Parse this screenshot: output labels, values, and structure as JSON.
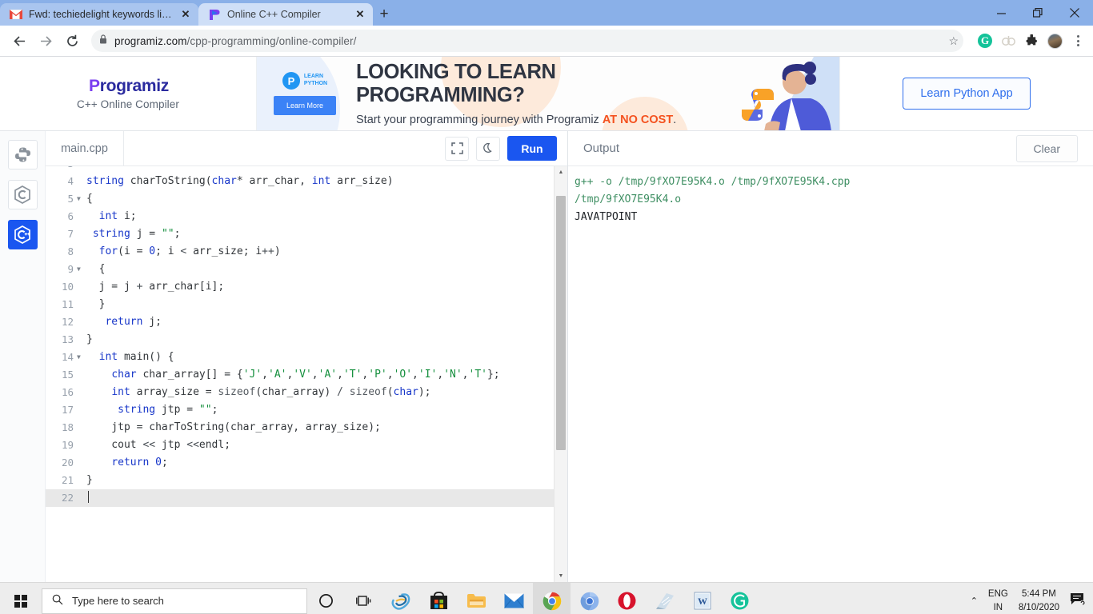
{
  "browser": {
    "tabs": [
      {
        "title": "Fwd: techiedelight keywords list -",
        "favicon": "gmail-icon",
        "active": false
      },
      {
        "title": "Online C++ Compiler",
        "favicon": "programiz-icon",
        "active": true
      }
    ],
    "newtab_label": "+",
    "window_controls": {
      "minimize": "—",
      "restore": "❐",
      "close": "✕"
    },
    "nav": {
      "back": "←",
      "forward": "→",
      "reload": "⟳"
    },
    "omnibox": {
      "lock_icon": "lock-icon",
      "domain": "programiz.com",
      "path": "/cpp-programming/online-compiler/",
      "full_url": "programiz.com/cpp-programming/online-compiler/",
      "star_icon": "☆"
    },
    "extensions": [
      {
        "name": "grammarly-extension-icon",
        "glyph": "G"
      },
      {
        "name": "link-extension-icon",
        "glyph": ""
      },
      {
        "name": "puzzle-extensions-icon",
        "glyph": ""
      },
      {
        "name": "profile-avatar",
        "glyph": ""
      }
    ]
  },
  "site": {
    "brand": {
      "logo_text": "rogramiz",
      "logo_first": "P",
      "subtitle": "C++ Online Compiler"
    },
    "ad": {
      "badge_line1": "LEARN",
      "badge_line2": "PYTHON",
      "badge_glyph": "P",
      "learn_more": "Learn More",
      "headline": "LOOKING TO LEARN PROGRAMMING?",
      "subline_pre": "Start your programming journey with Programiz ",
      "subline_bold": "AT NO COST",
      "subline_post": ".",
      "cta": "Learn Python App"
    }
  },
  "ide": {
    "languages": [
      {
        "name": "python-language-button",
        "label": "Python",
        "active": false
      },
      {
        "name": "c-language-button",
        "label": "C",
        "active": false
      },
      {
        "name": "cpp-language-button",
        "label": "C++",
        "active": true
      }
    ],
    "editor": {
      "filename": "main.cpp",
      "fullscreen_icon": "fullscreen-icon",
      "darkmode_icon": "moon-icon",
      "run_label": "Run",
      "current_line": 22,
      "lines": [
        {
          "n": 3,
          "fold": false,
          "clipped": true,
          "tokens": []
        },
        {
          "n": 4,
          "fold": false,
          "tokens": [
            {
              "t": "kw",
              "v": "string"
            },
            {
              "t": "ctext",
              "v": " charToString("
            },
            {
              "t": "kw",
              "v": "char"
            },
            {
              "t": "ctext",
              "v": "* arr_char, "
            },
            {
              "t": "kw",
              "v": "int"
            },
            {
              "t": "ctext",
              "v": " arr_size)"
            }
          ]
        },
        {
          "n": 5,
          "fold": true,
          "tokens": [
            {
              "t": "ctext",
              "v": "{"
            }
          ]
        },
        {
          "n": 6,
          "fold": false,
          "tokens": [
            {
              "t": "ctext",
              "v": "  "
            },
            {
              "t": "kw",
              "v": "int"
            },
            {
              "t": "ctext",
              "v": " i;"
            }
          ]
        },
        {
          "n": 7,
          "fold": false,
          "tokens": [
            {
              "t": "ctext",
              "v": " "
            },
            {
              "t": "kw",
              "v": "string"
            },
            {
              "t": "ctext",
              "v": " j = "
            },
            {
              "t": "str",
              "v": "\"\""
            },
            {
              "t": "ctext",
              "v": ";"
            }
          ]
        },
        {
          "n": 8,
          "fold": false,
          "tokens": [
            {
              "t": "ctext",
              "v": "  "
            },
            {
              "t": "kw",
              "v": "for"
            },
            {
              "t": "ctext",
              "v": "(i = "
            },
            {
              "t": "num",
              "v": "0"
            },
            {
              "t": "ctext",
              "v": "; i "
            },
            {
              "t": "op",
              "v": "<"
            },
            {
              "t": "ctext",
              "v": " arr_size; i"
            },
            {
              "t": "op",
              "v": "++"
            },
            {
              "t": "ctext",
              "v": ")"
            }
          ]
        },
        {
          "n": 9,
          "fold": true,
          "tokens": [
            {
              "t": "ctext",
              "v": "  {"
            }
          ]
        },
        {
          "n": 10,
          "fold": false,
          "tokens": [
            {
              "t": "ctext",
              "v": "  j = j "
            },
            {
              "t": "op",
              "v": "+"
            },
            {
              "t": "ctext",
              "v": " arr_char[i];"
            }
          ]
        },
        {
          "n": 11,
          "fold": false,
          "tokens": [
            {
              "t": "ctext",
              "v": "  }"
            }
          ]
        },
        {
          "n": 12,
          "fold": false,
          "tokens": [
            {
              "t": "ctext",
              "v": "   "
            },
            {
              "t": "kw",
              "v": "return"
            },
            {
              "t": "ctext",
              "v": " j;"
            }
          ]
        },
        {
          "n": 13,
          "fold": false,
          "tokens": [
            {
              "t": "ctext",
              "v": "}"
            }
          ]
        },
        {
          "n": 14,
          "fold": true,
          "tokens": [
            {
              "t": "ctext",
              "v": "  "
            },
            {
              "t": "kw",
              "v": "int"
            },
            {
              "t": "ctext",
              "v": " main() {"
            }
          ]
        },
        {
          "n": 15,
          "fold": false,
          "tokens": [
            {
              "t": "ctext",
              "v": "    "
            },
            {
              "t": "kw",
              "v": "char"
            },
            {
              "t": "ctext",
              "v": " char_array[] = {"
            },
            {
              "t": "str",
              "v": "'J'"
            },
            {
              "t": "ctext",
              "v": ","
            },
            {
              "t": "str",
              "v": "'A'"
            },
            {
              "t": "ctext",
              "v": ","
            },
            {
              "t": "str",
              "v": "'V'"
            },
            {
              "t": "ctext",
              "v": ","
            },
            {
              "t": "str",
              "v": "'A'"
            },
            {
              "t": "ctext",
              "v": ","
            },
            {
              "t": "str",
              "v": "'T'"
            },
            {
              "t": "ctext",
              "v": ","
            },
            {
              "t": "str",
              "v": "'P'"
            },
            {
              "t": "ctext",
              "v": ","
            },
            {
              "t": "str",
              "v": "'O'"
            },
            {
              "t": "ctext",
              "v": ","
            },
            {
              "t": "str",
              "v": "'I'"
            },
            {
              "t": "ctext",
              "v": ","
            },
            {
              "t": "str",
              "v": "'N'"
            },
            {
              "t": "ctext",
              "v": ","
            },
            {
              "t": "str",
              "v": "'T'"
            },
            {
              "t": "ctext",
              "v": "};"
            }
          ]
        },
        {
          "n": 16,
          "fold": false,
          "tokens": [
            {
              "t": "ctext",
              "v": "    "
            },
            {
              "t": "kw",
              "v": "int"
            },
            {
              "t": "ctext",
              "v": " array_size = "
            },
            {
              "t": "fn",
              "v": "sizeof"
            },
            {
              "t": "ctext",
              "v": "(char_array) "
            },
            {
              "t": "op",
              "v": "/"
            },
            {
              "t": "ctext",
              "v": " "
            },
            {
              "t": "fn",
              "v": "sizeof"
            },
            {
              "t": "ctext",
              "v": "("
            },
            {
              "t": "kw",
              "v": "char"
            },
            {
              "t": "ctext",
              "v": ");"
            }
          ]
        },
        {
          "n": 17,
          "fold": false,
          "tokens": [
            {
              "t": "ctext",
              "v": "     "
            },
            {
              "t": "kw",
              "v": "string"
            },
            {
              "t": "ctext",
              "v": " jtp = "
            },
            {
              "t": "str",
              "v": "\"\""
            },
            {
              "t": "ctext",
              "v": ";"
            }
          ]
        },
        {
          "n": 18,
          "fold": false,
          "tokens": [
            {
              "t": "ctext",
              "v": "    jtp = charToString(char_array, array_size);"
            }
          ]
        },
        {
          "n": 19,
          "fold": false,
          "tokens": [
            {
              "t": "ctext",
              "v": "    cout "
            },
            {
              "t": "op",
              "v": "<<"
            },
            {
              "t": "ctext",
              "v": " jtp "
            },
            {
              "t": "op",
              "v": "<<"
            },
            {
              "t": "ctext",
              "v": "endl;"
            }
          ]
        },
        {
          "n": 20,
          "fold": false,
          "tokens": [
            {
              "t": "ctext",
              "v": "    "
            },
            {
              "t": "kw",
              "v": "return"
            },
            {
              "t": "ctext",
              "v": " "
            },
            {
              "t": "num",
              "v": "0"
            },
            {
              "t": "ctext",
              "v": ";"
            }
          ]
        },
        {
          "n": 21,
          "fold": false,
          "tokens": [
            {
              "t": "ctext",
              "v": "}"
            }
          ]
        },
        {
          "n": 22,
          "fold": false,
          "tokens": []
        }
      ]
    },
    "output": {
      "title": "Output",
      "clear_label": "Clear",
      "lines": [
        {
          "kind": "cmd",
          "text": "g++ -o /tmp/9fXO7E95K4.o /tmp/9fXO7E95K4.cpp"
        },
        {
          "kind": "cmd",
          "text": "/tmp/9fXO7E95K4.o"
        },
        {
          "kind": "res",
          "text": "JAVATPOINT"
        }
      ]
    }
  },
  "taskbar": {
    "start_icon": "windows-start-icon",
    "search_placeholder": "Type here to search",
    "search_icon": "search-icon",
    "cortana_icon": "cortana-icon",
    "taskview_icon": "task-view-icon",
    "apps": [
      {
        "name": "internet-explorer-icon",
        "label": "Internet Explorer",
        "state": "idle"
      },
      {
        "name": "microsoft-store-icon",
        "label": "Microsoft Store",
        "state": "idle"
      },
      {
        "name": "file-explorer-icon",
        "label": "File Explorer",
        "state": "running"
      },
      {
        "name": "mail-icon",
        "label": "Mail",
        "state": "idle"
      },
      {
        "name": "chrome-icon",
        "label": "Google Chrome",
        "state": "active"
      },
      {
        "name": "chromium-icon",
        "label": "Chromium",
        "state": "idle"
      },
      {
        "name": "opera-icon",
        "label": "Opera",
        "state": "idle"
      },
      {
        "name": "notepad-icon",
        "label": "Notepad",
        "state": "running"
      },
      {
        "name": "word-icon",
        "label": "Microsoft Word",
        "state": "running"
      },
      {
        "name": "grammarly-icon",
        "label": "Grammarly",
        "state": "running"
      }
    ],
    "tray": {
      "chevron": "⌃",
      "lang_line1": "ENG",
      "lang_line2": "IN",
      "time": "5:44 PM",
      "date": "8/10/2020",
      "notification_icon": "notification-icon"
    }
  },
  "colors": {
    "accent": "#1a56f0",
    "tabstrip": "#8ab0e8",
    "keyword": "#1736c9",
    "string": "#148f3d",
    "output_cmd": "#3f8f63",
    "ad_highlight": "#f4511e"
  }
}
